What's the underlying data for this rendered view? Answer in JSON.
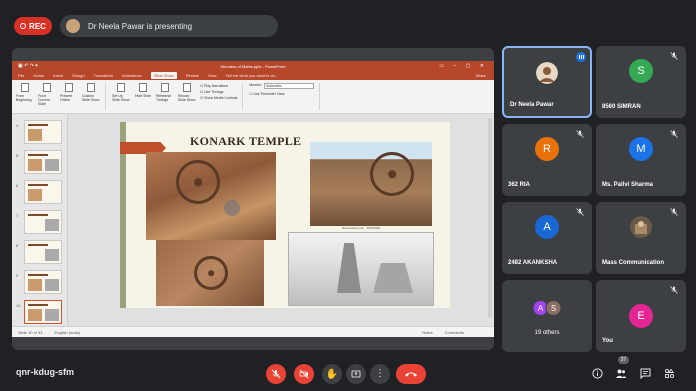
{
  "recording": {
    "label": "REC",
    "color": "#d93025"
  },
  "presenting": {
    "text": "Dr Neela Pawar is presenting"
  },
  "powerpoint": {
    "window_title": "Wonders of Maths.pptx - PowerPoint",
    "tabs": [
      "File",
      "Home",
      "Insert",
      "Design",
      "Transitions",
      "Animations",
      "Slide Show",
      "Review",
      "View"
    ],
    "active_tab": "Slide Show",
    "tell_me": "Tell me what you want to do...",
    "share": "Share",
    "ribbon": {
      "from_beginning": "From Beginning",
      "from_current": "From Current Slide",
      "present_online": "Present Online",
      "custom_slide_show": "Custom Slide Show",
      "setup_slide_show": "Set Up Slide Show",
      "hide_slide": "Hide Slide",
      "rehearse_timings": "Rehearse Timings",
      "record_slide_show": "Record Slide Show",
      "play_narrations": "Play Narrations",
      "use_timings": "Use Timings",
      "show_media_controls": "Show Media Controls",
      "monitor_label": "Monitor:",
      "monitor_value": "Automatic",
      "use_presenter_view": "Use Presenter View",
      "group_start": "Start Slide Show",
      "group_setup": "Set Up",
      "group_monitors": "Monitors"
    },
    "slide_numbers": [
      "4",
      "5",
      "6",
      "7",
      "8",
      "9",
      "10"
    ],
    "slide": {
      "title": "KONARK TEMPLE",
      "caption": "dreamstime.com · 15823966"
    },
    "status": {
      "slide_of": "Slide 10 of 33",
      "language": "English (India)",
      "notes": "Notes",
      "comments": "Comments"
    }
  },
  "participants": [
    {
      "name": "Dr Neela Pawar",
      "type": "photo",
      "speaking": true
    },
    {
      "name": "8560 SIMRAN",
      "initial": "S",
      "color": "#34a853",
      "muted": true
    },
    {
      "name": "362 RIA",
      "initial": "R",
      "color": "#e8710a",
      "muted": true
    },
    {
      "name": "Ms. Pallvi Sharma",
      "initial": "M",
      "color": "#1a73e8",
      "muted": true
    },
    {
      "name": "2482 AKANKSHA",
      "initial": "A",
      "color": "#1967d2",
      "muted": true
    },
    {
      "name": "Mass Communication",
      "type": "photo",
      "muted": true
    },
    {
      "name": "19 others",
      "initials": [
        "A",
        "S"
      ],
      "colors": [
        "#a142f4",
        "#8d6e63"
      ]
    },
    {
      "name": "You",
      "initial": "E",
      "color": "#e52592",
      "muted": true
    }
  ],
  "bottom": {
    "meeting_code": "qnr-kdug-sfm",
    "people_count": "27",
    "controls": [
      "mic-off",
      "camera-off",
      "raise-hand",
      "present-screen",
      "more-options",
      "leave-call"
    ]
  }
}
